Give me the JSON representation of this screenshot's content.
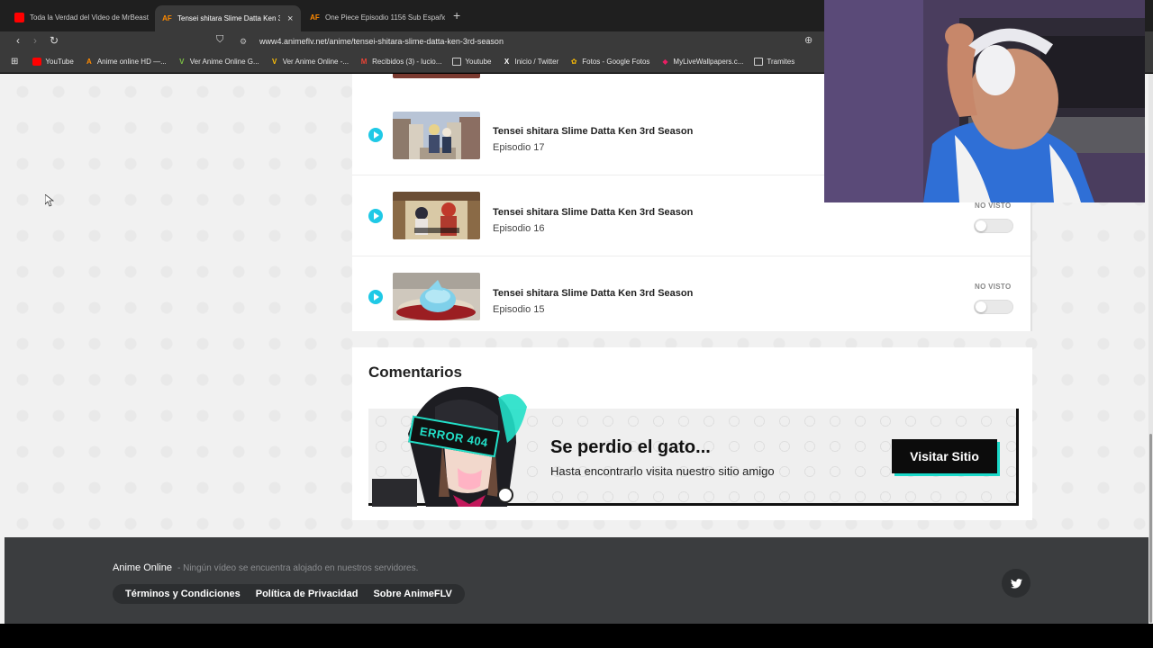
{
  "browser": {
    "tabs": [
      {
        "title": "Toda la Verdad del Video de MrBeast",
        "icon": "youtube-icon",
        "active": false
      },
      {
        "title": "Tensei shitara Slime Datta Ken 3r",
        "icon": "animeflv-icon",
        "active": true
      },
      {
        "title": "One Piece Episodio 1156 Sub Españo",
        "icon": "animeflv-icon",
        "active": false
      }
    ],
    "new_tab": "+",
    "url": "www4.animeflv.net/anime/tensei-shitara-slime-datta-ken-3rd-season",
    "bookmarks": [
      {
        "label": "YouTube",
        "icon": "youtube-icon"
      },
      {
        "label": "Anime online HD —...",
        "icon": "animeflv-icon"
      },
      {
        "label": "Ver Anime Online G...",
        "icon": "vanime-icon"
      },
      {
        "label": "Ver Anime Online -...",
        "icon": "vanime-icon"
      },
      {
        "label": "Recibidos (3) - lucio...",
        "icon": "gmail-icon"
      },
      {
        "label": "Youtube",
        "icon": "folder-icon"
      },
      {
        "label": "Inicio / Twitter",
        "icon": "x-icon"
      },
      {
        "label": "Fotos - Google Fotos",
        "icon": "photos-icon"
      },
      {
        "label": "MyLiveWallpapers.c...",
        "icon": "mlw-icon"
      },
      {
        "label": "Tramites",
        "icon": "folder-icon"
      }
    ]
  },
  "episodes": [
    {
      "title": "Tensei shitara Slime Datta Ken 3rd Season",
      "number": "Episodio 17",
      "status": ""
    },
    {
      "title": "Tensei shitara Slime Datta Ken 3rd Season",
      "number": "Episodio 16",
      "status": "NO VISTO"
    },
    {
      "title": "Tensei shitara Slime Datta Ken 3rd Season",
      "number": "Episodio 15",
      "status": "NO VISTO"
    }
  ],
  "comments": {
    "heading": "Comentarios",
    "banner": {
      "badge": "ERROR 404",
      "title": "Se perdio el gato...",
      "subtitle": "Hasta encontrarlo visita nuestro sitio amigo",
      "button": "Visitar Sitio"
    }
  },
  "footer": {
    "brand": "Anime Online",
    "note": "- Ningún vídeo se encuentra alojado en nuestros servidores.",
    "links": [
      "Términos y Condiciones",
      "Política de Privacidad",
      "Sobre AnimeFLV"
    ]
  },
  "colors": {
    "accent": "#1fc9e6",
    "banner_shadow": "#19d8c8",
    "footer": "#3b3d3f"
  }
}
